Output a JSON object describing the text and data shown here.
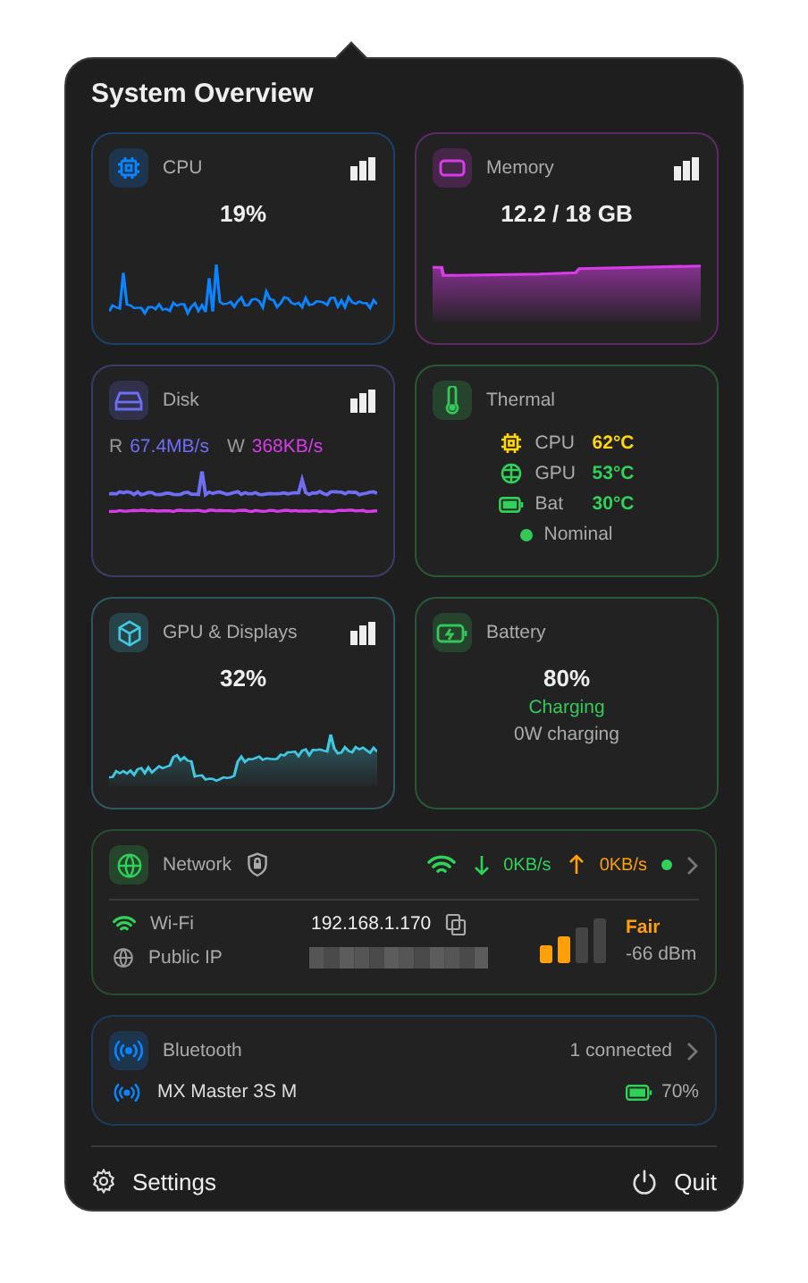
{
  "title": "System Overview",
  "cards": [
    {
      "kind": "cpu",
      "label": "CPU",
      "value": "19%",
      "color": "#0a84ff"
    },
    {
      "kind": "memory",
      "label": "Memory",
      "value": "12.2 / 18 GB",
      "color": "#d63ce8"
    },
    {
      "kind": "disk",
      "label": "Disk",
      "read_label": "R",
      "read": "67.4MB/s",
      "write_label": "W",
      "write": "368KB/s",
      "color": "#6e6ef5"
    },
    {
      "kind": "thermal",
      "label": "Thermal",
      "color": "#34c759",
      "readings": [
        {
          "kind": "cpu",
          "label": "CPU",
          "value": "62°C",
          "color": "#ffd60a"
        },
        {
          "kind": "gpu",
          "label": "GPU",
          "value": "53°C",
          "color": "#30d158"
        },
        {
          "kind": "battery",
          "label": "Bat",
          "value": "30°C",
          "color": "#30d158"
        }
      ],
      "status": "Nominal"
    },
    {
      "kind": "gpu",
      "label": "GPU & Displays",
      "value": "32%",
      "color": "#40c8e0"
    },
    {
      "kind": "battery",
      "label": "Battery",
      "value": "80%",
      "status": "Charging",
      "detail": "0W charging",
      "color": "#34c759"
    }
  ],
  "network": {
    "label": "Network",
    "down": "0KB/s",
    "up": "0KB/s",
    "connected": true,
    "wifi_label": "Wi-Fi",
    "ip": "192.168.1.170",
    "public_ip_label": "Public IP",
    "quality": "Fair",
    "strength": "-66 dBm"
  },
  "bluetooth": {
    "label": "Bluetooth",
    "status": "1 connected",
    "devices": [
      {
        "name": "MX Master 3S M",
        "battery": "70%"
      }
    ]
  },
  "footer": {
    "settings": "Settings",
    "quit": "Quit"
  }
}
